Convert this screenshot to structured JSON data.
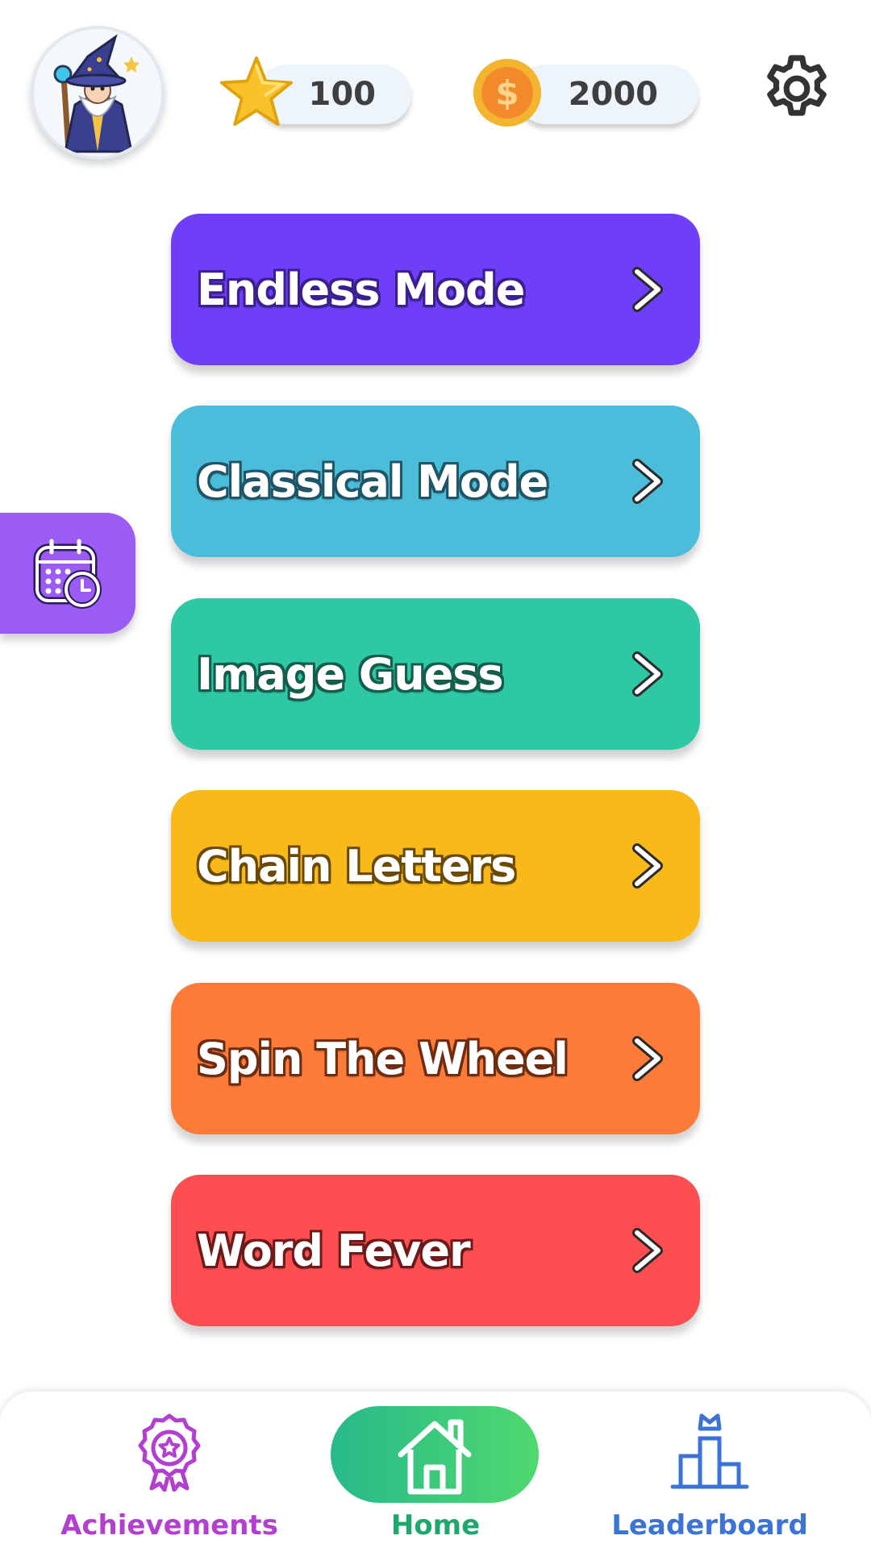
{
  "header": {
    "stars": "100",
    "coins": "2000"
  },
  "modes": [
    {
      "label": "Endless Mode",
      "color": "#6e3ef8",
      "stroke": "#3b1e8f"
    },
    {
      "label": "Classical Mode",
      "color": "#4cbcdb",
      "stroke": "#1f5566"
    },
    {
      "label": "Image Guess",
      "color": "#2ec9a4",
      "stroke": "#145c4c"
    },
    {
      "label": "Chain Letters",
      "color": "#f8b919",
      "stroke": "#6b4a05"
    },
    {
      "label": "Spin The Wheel",
      "color": "#fd7b39",
      "stroke": "#6e2d10"
    },
    {
      "label": "Word Fever",
      "color": "#fd4f51",
      "stroke": "#6e1a1b"
    }
  ],
  "nav": {
    "achievements": "Achievements",
    "home": "Home",
    "leaderboard": "Leaderboard",
    "colors": {
      "achievements": "#b23fd0",
      "home": "#1fa86d",
      "leaderboard": "#3b74d6"
    }
  }
}
